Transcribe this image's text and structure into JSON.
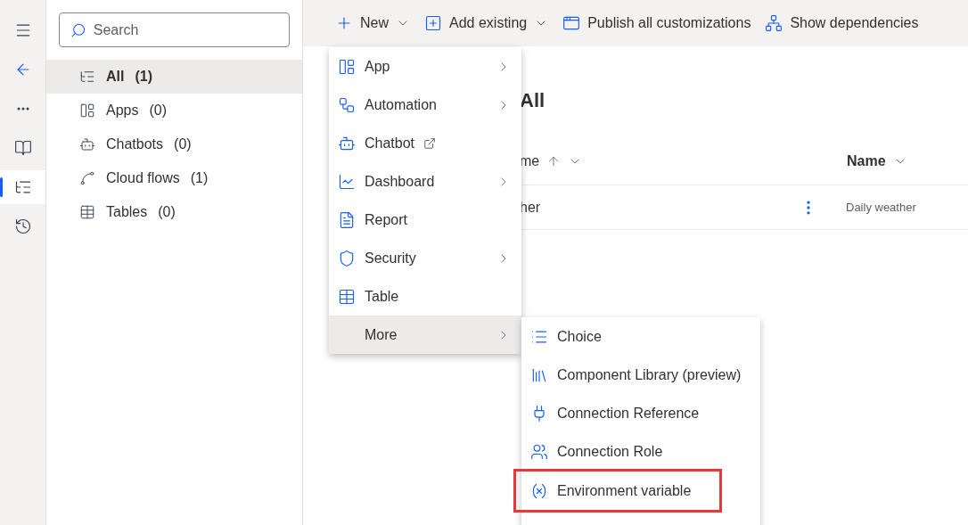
{
  "rail": [
    {
      "kind": "menu",
      "selected": false
    },
    {
      "kind": "back",
      "selected": false
    },
    {
      "kind": "more",
      "selected": false
    },
    {
      "kind": "objects",
      "selected": false
    },
    {
      "kind": "overview",
      "selected": true
    },
    {
      "kind": "history",
      "selected": false
    }
  ],
  "sidebar": {
    "search": {
      "placeholder": "Search"
    },
    "items": [
      {
        "kind": "all",
        "label": "All",
        "count": "(1)",
        "selected": true
      },
      {
        "kind": "apps",
        "label": "Apps",
        "count": "(0)",
        "selected": false
      },
      {
        "kind": "chatbots",
        "label": "Chatbots",
        "count": "(0)",
        "selected": false
      },
      {
        "kind": "flows",
        "label": "Cloud flows",
        "count": "(1)",
        "selected": false
      },
      {
        "kind": "tables",
        "label": "Tables",
        "count": "(0)",
        "selected": false
      }
    ]
  },
  "toolbar": [
    {
      "kind": "new",
      "label": "New",
      "dropdown": true
    },
    {
      "kind": "add",
      "label": "Add existing",
      "dropdown": true
    },
    {
      "kind": "publish",
      "label": "Publish all customizations",
      "dropdown": false
    },
    {
      "kind": "dependencies",
      "label": "Show dependencies",
      "dropdown": false
    }
  ],
  "main": {
    "heading": "All",
    "columns": [
      {
        "label": "me",
        "sorted": true
      },
      {
        "label": "Name",
        "sorted": false
      }
    ],
    "rows": [
      {
        "cells": [
          "her",
          "Daily weather"
        ]
      }
    ]
  },
  "menu": {
    "items": [
      {
        "kind": "app",
        "label": "App",
        "submenu": true,
        "external": false,
        "selected": false
      },
      {
        "kind": "automation",
        "label": "Automation",
        "submenu": true,
        "external": false,
        "selected": false
      },
      {
        "kind": "chatbot",
        "label": "Chatbot",
        "submenu": false,
        "external": true,
        "selected": false
      },
      {
        "kind": "dashboard",
        "label": "Dashboard",
        "submenu": true,
        "external": false,
        "selected": false
      },
      {
        "kind": "report",
        "label": "Report",
        "submenu": false,
        "external": false,
        "selected": false
      },
      {
        "kind": "security",
        "label": "Security",
        "submenu": true,
        "external": false,
        "selected": false
      },
      {
        "kind": "table",
        "label": "Table",
        "submenu": false,
        "external": false,
        "selected": false
      },
      {
        "kind": "none",
        "label": "More",
        "submenu": true,
        "external": false,
        "selected": true
      }
    ]
  },
  "submenu": {
    "items": [
      {
        "kind": "choice",
        "label": "Choice",
        "highlighted": false
      },
      {
        "kind": "library",
        "label": "Component Library (preview)",
        "highlighted": false
      },
      {
        "kind": "plug",
        "label": "Connection Reference",
        "highlighted": false
      },
      {
        "kind": "role",
        "label": "Connection Role",
        "highlighted": false
      },
      {
        "kind": "variable",
        "label": "Environment variable",
        "highlighted": true
      }
    ]
  }
}
